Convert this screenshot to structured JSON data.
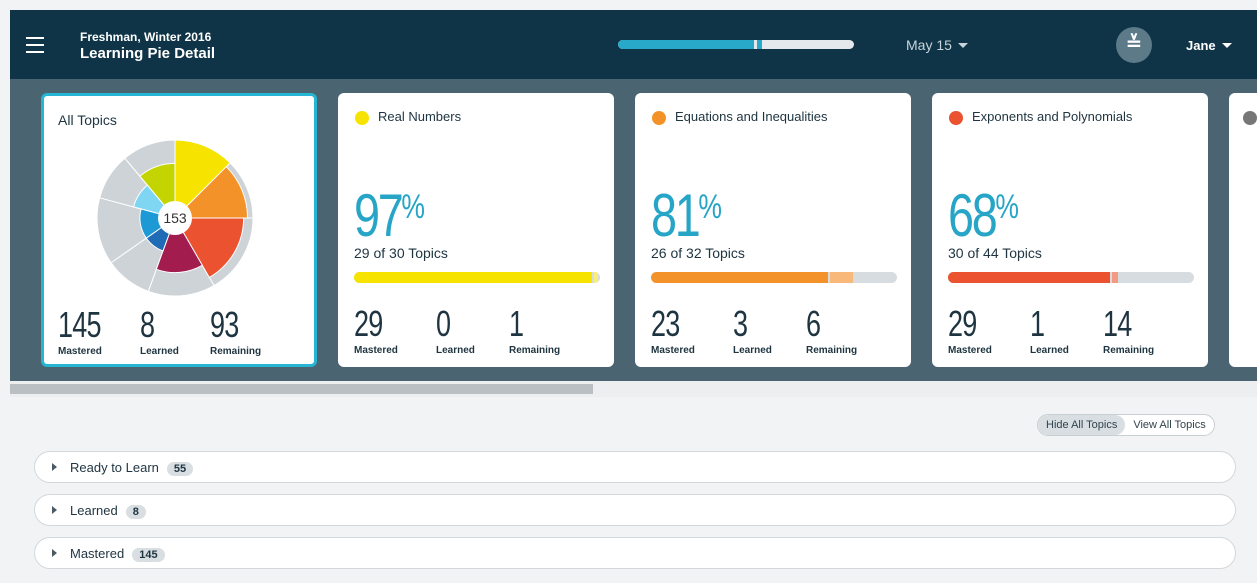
{
  "header": {
    "subtitle": "Freshman, Winter 2016",
    "title": "Learning Pie Detail",
    "date": "May 15",
    "avatar_glyph": "≚",
    "user": "Jane",
    "progress_fraction": 0.61
  },
  "all_topics": {
    "title": "All Topics",
    "center": "153",
    "mastered": "145",
    "learned": "8",
    "remaining": "93",
    "mastered_label": "Mastered",
    "learned_label": "Learned",
    "remaining_label": "Remaining"
  },
  "cards": [
    {
      "title": "Real Numbers",
      "color": "#f7e300",
      "pct": "97",
      "pct_sym": "%",
      "topics": "29 of 30 Topics",
      "mastered": "29",
      "learned": "0",
      "remaining": "1",
      "mastered_frac": 0.967,
      "learned_frac": 0.0,
      "light_color": "#f8ee7a"
    },
    {
      "title": "Equations and Inequalities",
      "color": "#f4922a",
      "pct": "81",
      "pct_sym": "%",
      "topics": "26 of 32 Topics",
      "mastered": "23",
      "learned": "3",
      "remaining": "6",
      "mastered_frac": 0.719,
      "learned_frac": 0.094,
      "light_color": "#f8b87a"
    },
    {
      "title": "Exponents and Polynomials",
      "color": "#ea5230",
      "pct": "68",
      "pct_sym": "%",
      "topics": "30 of 44 Topics",
      "mastered": "29",
      "learned": "1",
      "remaining": "14",
      "mastered_frac": 0.659,
      "learned_frac": 0.023,
      "light_color": "#f39a82"
    }
  ],
  "labels": {
    "mastered": "Mastered",
    "learned": "Learned",
    "remaining": "Remaining"
  },
  "toggle": {
    "hide": "Hide All Topics",
    "view": "View All Topics"
  },
  "rows": [
    {
      "label": "Ready to Learn",
      "count": "55"
    },
    {
      "label": "Learned",
      "count": "8"
    },
    {
      "label": "Mastered",
      "count": "145"
    }
  ],
  "pie_colors": {
    "yellow": "#f7e300",
    "orange": "#f4922a",
    "red": "#ea5230",
    "maroon": "#a31c4e",
    "blue_dark": "#1f6bb5",
    "blue": "#1d9ad6",
    "light_blue": "#7fd6f3",
    "lime": "#c3d400",
    "remaining": "#cdd3d7"
  }
}
